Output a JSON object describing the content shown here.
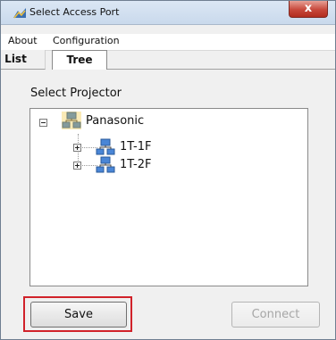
{
  "window": {
    "title": "Select Access Port",
    "close_glyph": "x"
  },
  "menu": {
    "items": [
      "About",
      "Configuration"
    ]
  },
  "tabs": [
    {
      "label": "List",
      "selected": false
    },
    {
      "label": "Tree",
      "selected": true
    }
  ],
  "tree": {
    "label": "Select Projector",
    "root": {
      "label": "Panasonic",
      "expanded": true,
      "icon": "network-icon"
    },
    "children": [
      {
        "label": "1T-1F",
        "expanded": false,
        "icon": "network-icon"
      },
      {
        "label": "1T-2F",
        "expanded": false,
        "icon": "network-icon"
      }
    ]
  },
  "buttons": {
    "save": "Save",
    "connect": "Connect"
  },
  "colors": {
    "highlight": "#d1222a",
    "close_button": "#c7483b"
  }
}
